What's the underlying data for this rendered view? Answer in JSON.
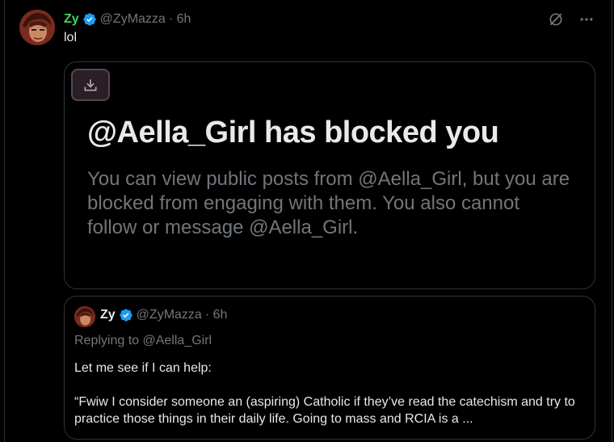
{
  "tweet": {
    "author_name": "Zy",
    "author_handle": "@ZyMazza",
    "time": "· 6h",
    "text": "lol"
  },
  "media": {
    "title": "@Aella_Girl has blocked you",
    "description": "You can view public posts from @Aella_Girl, but you are blocked from engaging with them. You also cannot follow or message @Aella_Girl."
  },
  "quote": {
    "author_name": "Zy",
    "author_handle": "@ZyMazza",
    "time": "· 6h",
    "replying_prefix": "Replying to ",
    "replying_handle": "@Aella_Girl",
    "line1": "Let me see if I can help:",
    "line2": "“Fwiw I consider someone an (aspiring) Catholic if they’ve read the catechism and try to practice those things in their daily life. Going to mass and RCIA is a ..."
  },
  "colors": {
    "background": "#000000",
    "name_green": "#46d160",
    "verified_blue": "#1d9bf0",
    "muted": "#71767b",
    "border": "#2f3336"
  },
  "icons": {
    "verified": "verified-badge-icon",
    "grok": "grok-icon",
    "more": "more-icon",
    "download": "download-icon"
  }
}
